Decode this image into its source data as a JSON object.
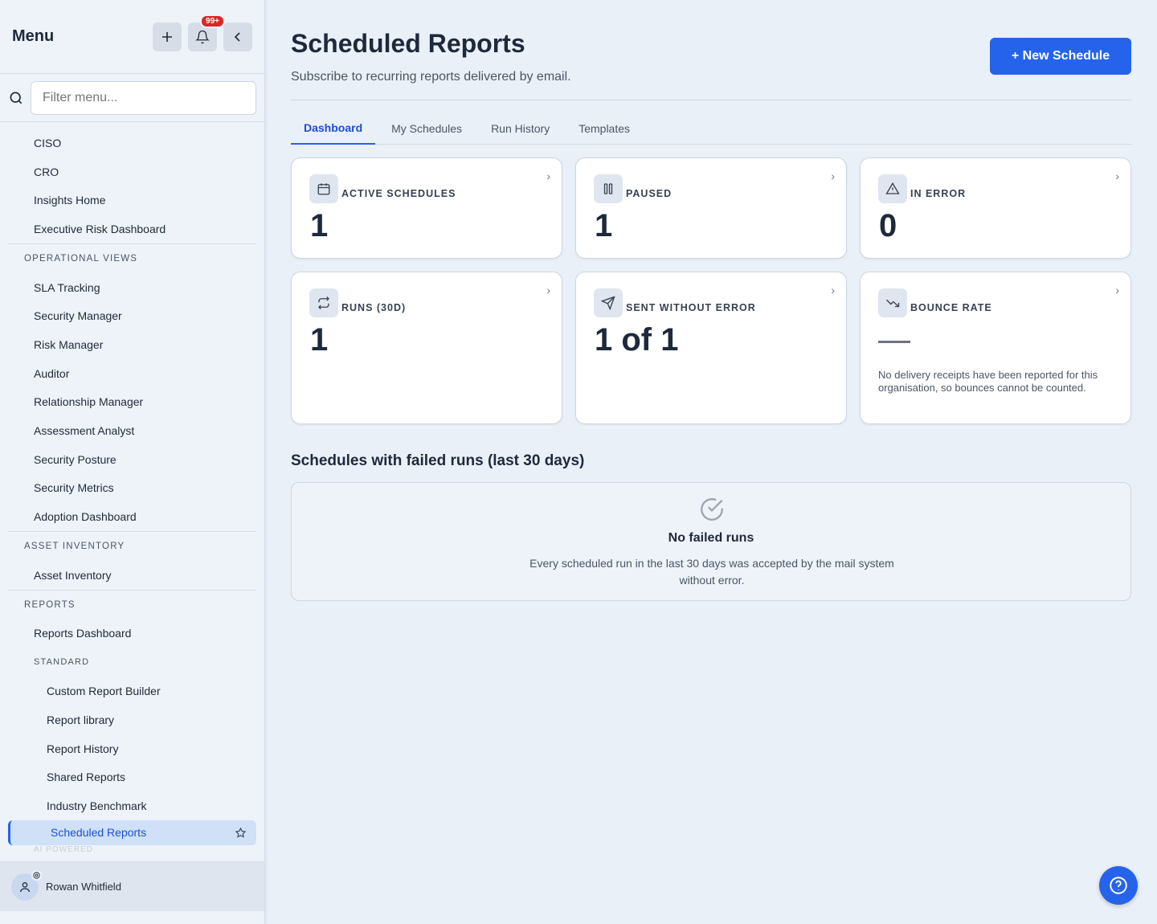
{
  "sidebar": {
    "title": "Menu",
    "notification_count": "99+",
    "filter_placeholder": "Filter menu...",
    "items_top": [
      "CISO",
      "CRO",
      "Insights Home",
      "Executive Risk Dashboard"
    ],
    "operational_views": {
      "heading": "OPERATIONAL VIEWS",
      "items": [
        "SLA Tracking",
        "Security Manager",
        "Risk Manager",
        "Auditor",
        "Relationship Manager",
        "Assessment Analyst",
        "Security Posture",
        "Security Metrics",
        "Adoption Dashboard"
      ]
    },
    "asset_inventory": {
      "heading": "ASSET INVENTORY",
      "items": [
        "Asset Inventory"
      ]
    },
    "reports": {
      "heading": "REPORTS",
      "dashboard": "Reports Dashboard",
      "standard_heading": "STANDARD",
      "standard_items": [
        "Custom Report Builder",
        "Report library",
        "Report History",
        "Shared Reports",
        "Industry Benchmark"
      ],
      "active_item": "Scheduled Reports"
    },
    "faded_heading": "AI POWERED",
    "user_name": "Rowan Whitfield"
  },
  "header": {
    "title": "Scheduled Reports",
    "subtitle": "Subscribe to recurring reports delivered by email.",
    "new_button": "+ New Schedule"
  },
  "tabs": [
    "Dashboard",
    "My Schedules",
    "Run History",
    "Templates"
  ],
  "active_tab": "Dashboard",
  "cards": {
    "active": {
      "label": "ACTIVE SCHEDULES",
      "value": "1",
      "icon": "calendar-icon"
    },
    "paused": {
      "label": "PAUSED",
      "value": "1",
      "icon": "pause-icon"
    },
    "error": {
      "label": "IN ERROR",
      "value": "0",
      "icon": "warning-icon"
    },
    "runs": {
      "label": "RUNS (30D)",
      "value": "1",
      "icon": "repeat-icon"
    },
    "sent": {
      "label": "SENT WITHOUT ERROR",
      "value": "1 of 1",
      "icon": "send-icon"
    },
    "bounce": {
      "label": "BOUNCE RATE",
      "value": "—",
      "icon": "trending-down-icon",
      "description": "No delivery receipts have been reported for this organisation, so bounces cannot be counted."
    }
  },
  "failed_section": {
    "title": "Schedules with failed runs (last 30 days)",
    "empty_title": "No failed runs",
    "empty_text": "Every scheduled run in the last 30 days was accepted by the mail system without error."
  },
  "colors": {
    "accent": "#2563eb",
    "background": "#eaf0f8",
    "badge": "#dc2626"
  }
}
